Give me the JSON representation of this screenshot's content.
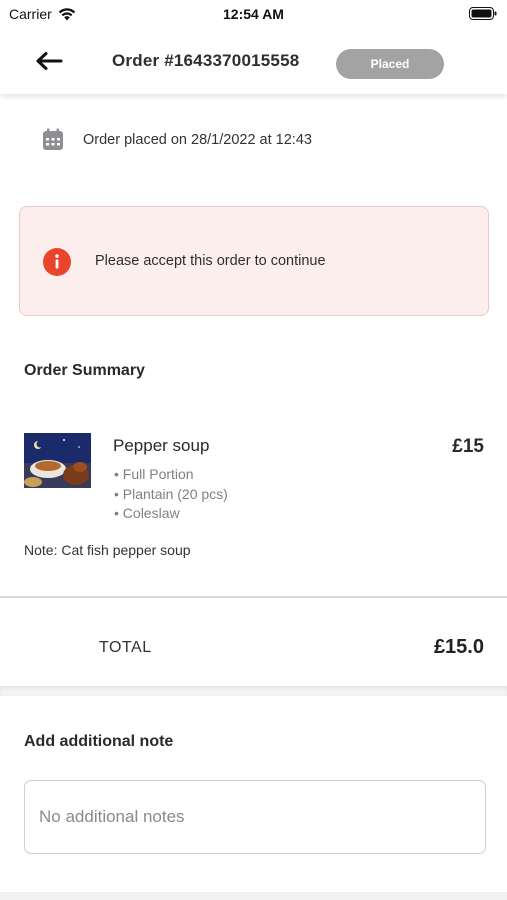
{
  "status_bar": {
    "carrier": "Carrier",
    "time": "12:54 AM"
  },
  "header": {
    "title": "Order #1643370015558",
    "status": "Placed",
    "back_icon": "arrow-left-icon"
  },
  "order_info": {
    "placed_text": "Order placed on 28/1/2022 at 12:43",
    "icon": "calendar-icon"
  },
  "alert": {
    "message": "Please accept this order to continue",
    "icon": "info-icon",
    "color": "#e8452c"
  },
  "summary": {
    "title": "Order Summary",
    "items": [
      {
        "name": "Pepper soup",
        "price": "£15",
        "options": [
          "• Full Portion",
          "• Plantain (20 pcs)",
          "• Coleslaw"
        ],
        "note": "Note: Cat fish pepper soup"
      }
    ]
  },
  "total": {
    "label": "TOTAL",
    "value": "£15.0"
  },
  "additional_note": {
    "title": "Add additional note",
    "placeholder": "No additional notes",
    "value": ""
  },
  "colors": {
    "alert_background": "#fdeeee",
    "status_pill": "#a3a3a3"
  }
}
